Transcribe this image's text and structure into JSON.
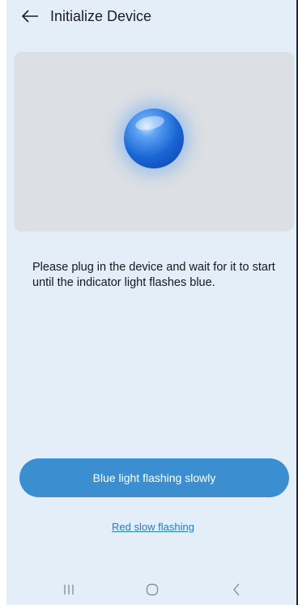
{
  "header": {
    "title": "Initialize Device",
    "back_icon": "arrow-left-icon"
  },
  "preview": {
    "indicator_color": "#1a66d6"
  },
  "instruction": {
    "text": "Please plug in the device and wait for it to start until the indicator light flashes blue."
  },
  "actions": {
    "primary_label": "Blue light flashing slowly",
    "secondary_label": "Red slow flashing",
    "accent_color": "#3b8fd0"
  },
  "navbar": {
    "recents_icon": "recents-icon",
    "home_icon": "home-icon",
    "back_icon": "back-chevron-icon"
  }
}
